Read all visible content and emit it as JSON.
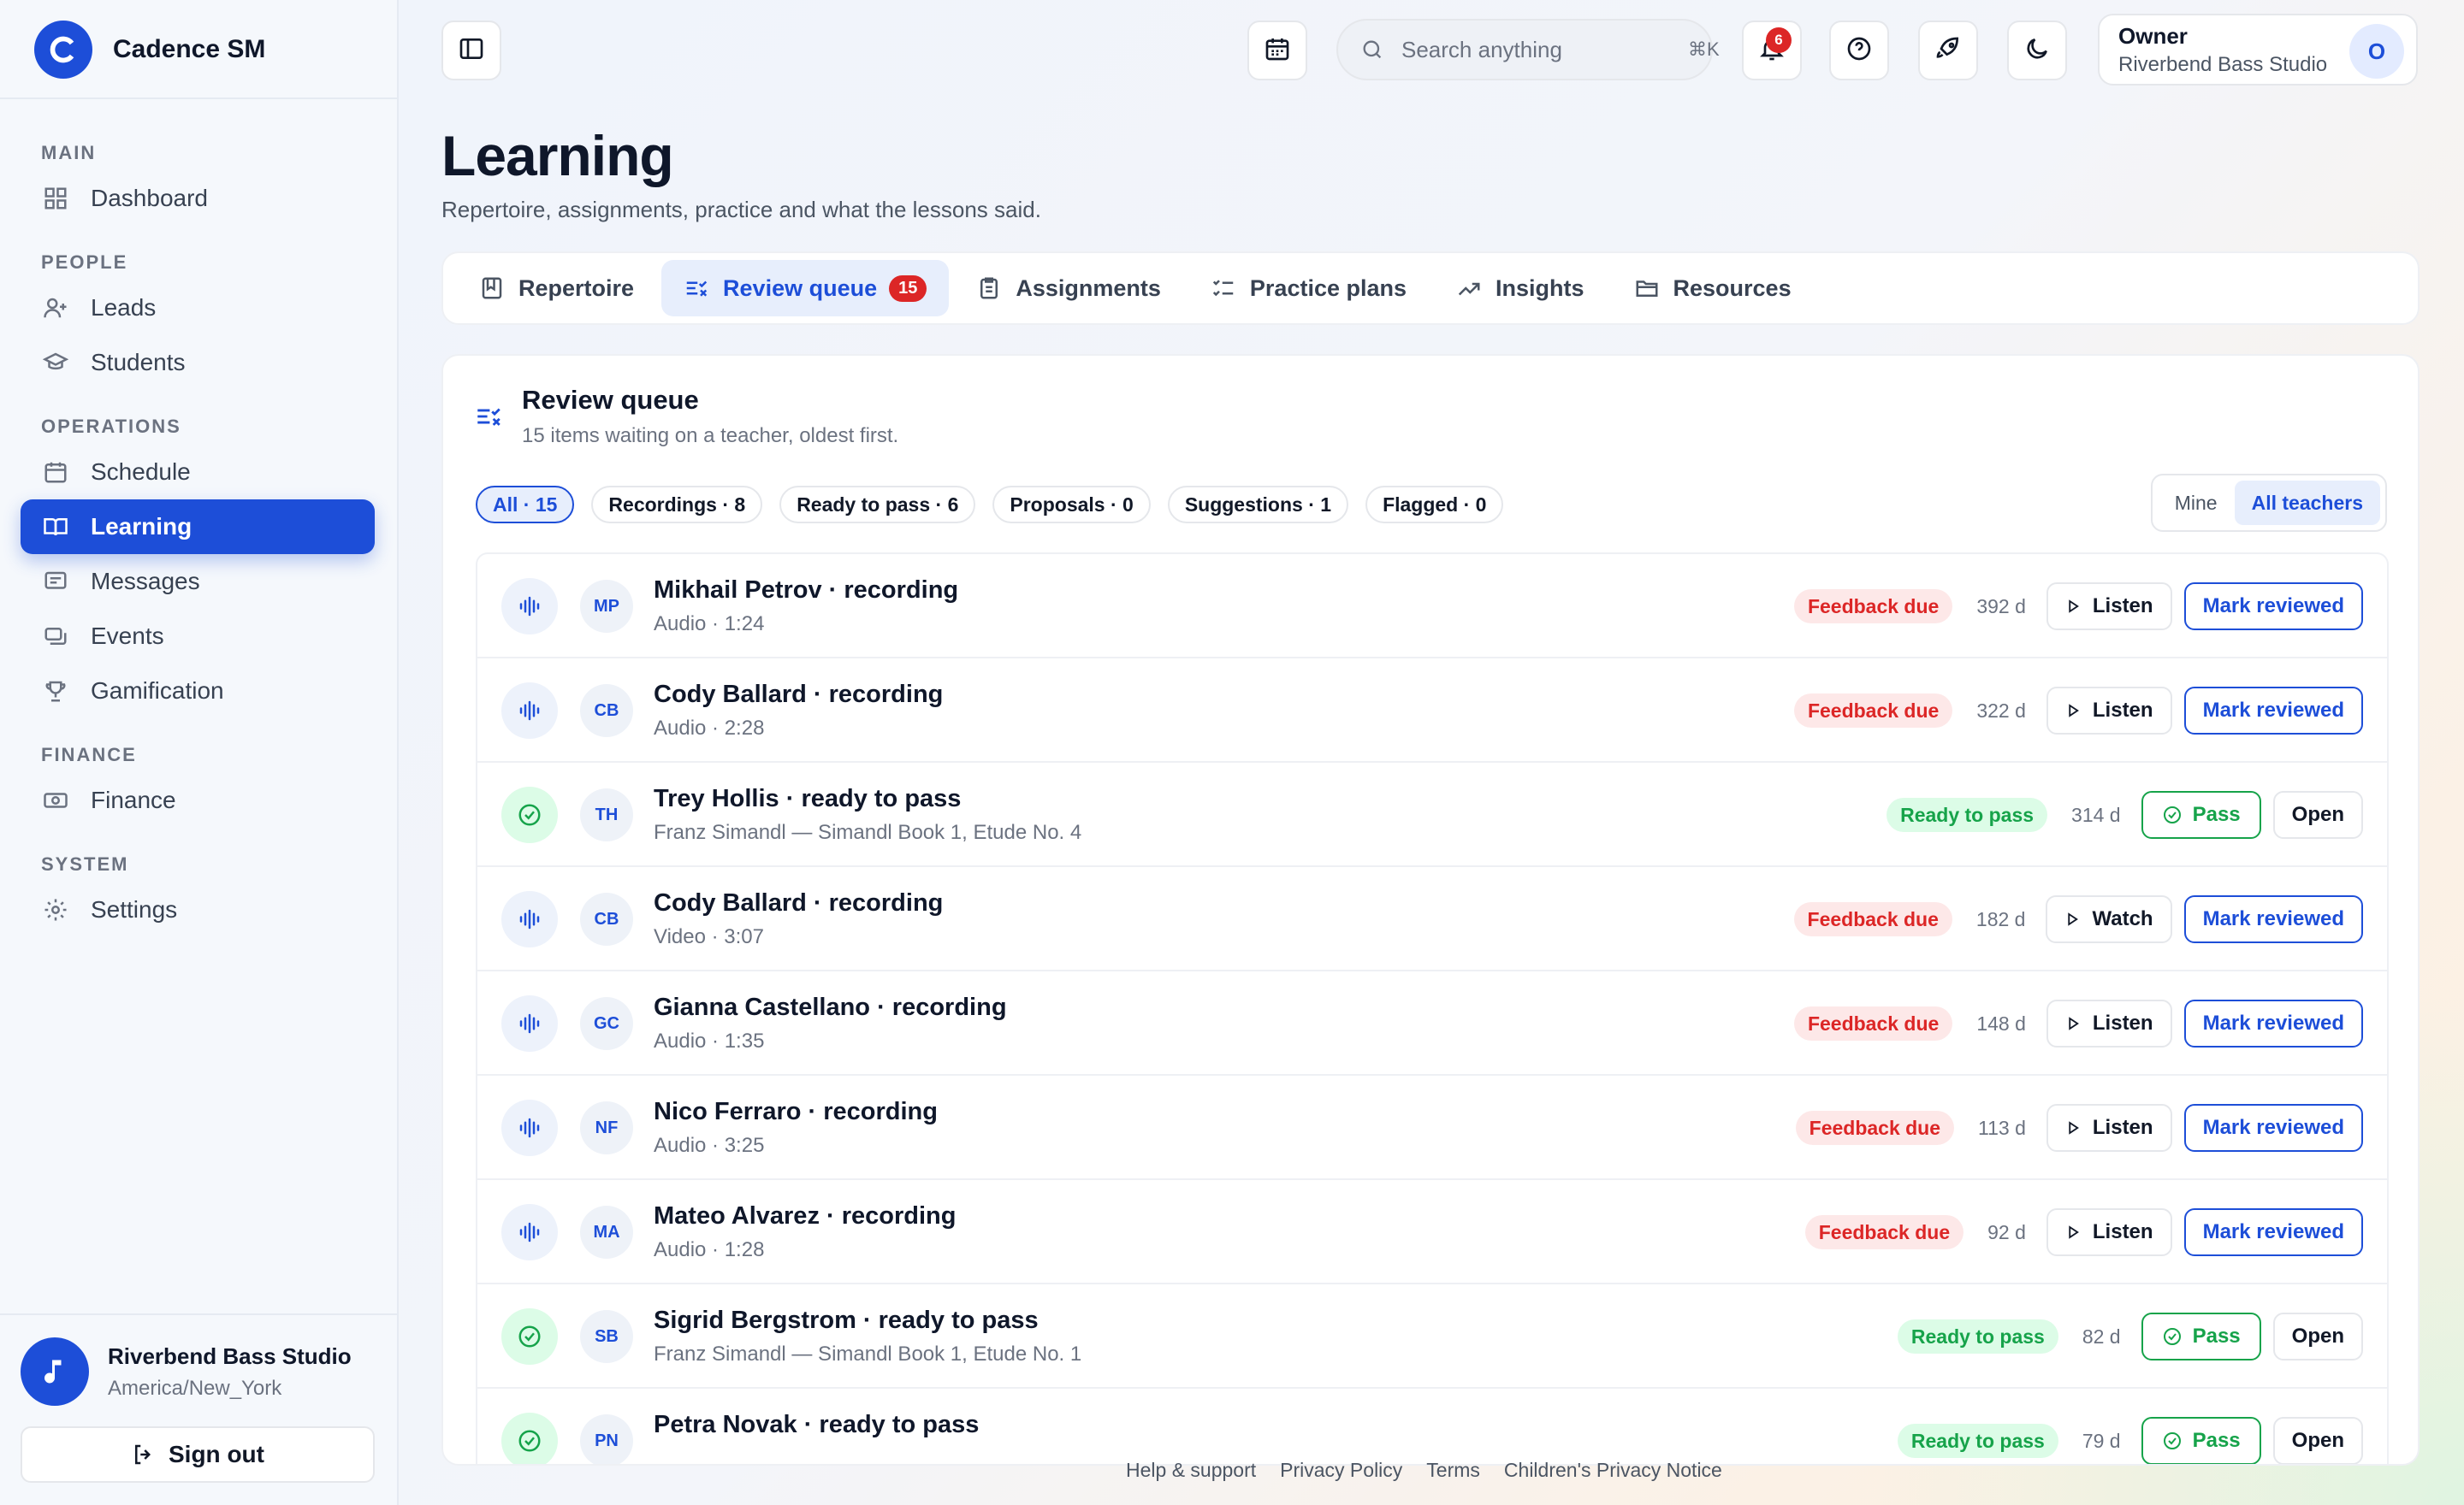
{
  "brand": {
    "logo_letter": "C",
    "name": "Cadence SM"
  },
  "sidebar": {
    "sections": [
      {
        "label": "MAIN"
      },
      {
        "label": "PEOPLE"
      },
      {
        "label": "OPERATIONS"
      },
      {
        "label": "FINANCE"
      },
      {
        "label": "SYSTEM"
      }
    ],
    "items": [
      {
        "label": "Dashboard",
        "icon": "dashboard-icon"
      },
      {
        "label": "Leads",
        "icon": "user-plus-icon"
      },
      {
        "label": "Students",
        "icon": "graduation-cap-icon"
      },
      {
        "label": "Schedule",
        "icon": "calendar-icon"
      },
      {
        "label": "Learning",
        "icon": "book-open-icon",
        "active": true
      },
      {
        "label": "Messages",
        "icon": "message-icon"
      },
      {
        "label": "Events",
        "icon": "ticket-icon"
      },
      {
        "label": "Gamification",
        "icon": "trophy-icon"
      },
      {
        "label": "Finance",
        "icon": "banknote-icon"
      },
      {
        "label": "Settings",
        "icon": "gear-icon"
      }
    ],
    "studio": {
      "name": "Riverbend Bass Studio",
      "timezone": "America/New_York",
      "avatar_icon": "music-note-icon"
    },
    "signout_label": "Sign out"
  },
  "topbar": {
    "search_placeholder": "Search anything",
    "search_shortcut": "⌘K",
    "notifications_count": "6",
    "owner": {
      "role": "Owner",
      "studio": "Riverbend Bass Studio",
      "avatar_letter": "O"
    }
  },
  "page": {
    "title": "Learning",
    "subtitle": "Repertoire, assignments, practice and what the lessons said."
  },
  "tabs": [
    {
      "label": "Repertoire",
      "icon": "repertoire-icon"
    },
    {
      "label": "Review queue",
      "icon": "review-queue-icon",
      "active": true,
      "count": "15"
    },
    {
      "label": "Assignments",
      "icon": "clipboard-icon"
    },
    {
      "label": "Practice plans",
      "icon": "checklist-icon"
    },
    {
      "label": "Insights",
      "icon": "trend-icon"
    },
    {
      "label": "Resources",
      "icon": "folder-icon"
    }
  ],
  "review": {
    "title": "Review queue",
    "subtitle": "15 items waiting on a teacher, oldest first.",
    "filters": [
      {
        "label": "All · 15",
        "active": true
      },
      {
        "label": "Recordings · 8"
      },
      {
        "label": "Ready to pass · 6"
      },
      {
        "label": "Proposals · 0"
      },
      {
        "label": "Suggestions · 1"
      },
      {
        "label": "Flagged · 0"
      }
    ],
    "scope": {
      "mine": "Mine",
      "all": "All teachers",
      "active": "all"
    },
    "rows": [
      {
        "kind": "recording",
        "initials": "MP",
        "title": "Mikhail Petrov · recording",
        "sub": "Audio · 1:24",
        "badge": "Feedback due",
        "age": "392  d",
        "primary": "Listen",
        "secondary": "Mark reviewed"
      },
      {
        "kind": "recording",
        "initials": "CB",
        "title": "Cody Ballard · recording",
        "sub": "Audio · 2:28",
        "badge": "Feedback due",
        "age": "322  d",
        "primary": "Listen",
        "secondary": "Mark reviewed"
      },
      {
        "kind": "pass",
        "initials": "TH",
        "title": "Trey Hollis · ready to pass",
        "sub": "Franz Simandl — Simandl Book 1, Etude No. 4",
        "badge": "Ready to pass",
        "age": "314  d",
        "primary": "Pass",
        "secondary": "Open"
      },
      {
        "kind": "recording",
        "initials": "CB",
        "title": "Cody Ballard · recording",
        "sub": "Video · 3:07",
        "badge": "Feedback due",
        "age": "182  d",
        "primary": "Watch",
        "secondary": "Mark reviewed"
      },
      {
        "kind": "recording",
        "initials": "GC",
        "title": "Gianna Castellano · recording",
        "sub": "Audio · 1:35",
        "badge": "Feedback due",
        "age": "148  d",
        "primary": "Listen",
        "secondary": "Mark reviewed"
      },
      {
        "kind": "recording",
        "initials": "NF",
        "title": "Nico Ferraro · recording",
        "sub": "Audio · 3:25",
        "badge": "Feedback due",
        "age": "113  d",
        "primary": "Listen",
        "secondary": "Mark reviewed"
      },
      {
        "kind": "recording",
        "initials": "MA",
        "title": "Mateo Alvarez · recording",
        "sub": "Audio · 1:28",
        "badge": "Feedback due",
        "age": "92  d",
        "primary": "Listen",
        "secondary": "Mark reviewed"
      },
      {
        "kind": "pass",
        "initials": "SB",
        "title": "Sigrid Bergstrom · ready to pass",
        "sub": "Franz Simandl — Simandl Book 1, Etude No. 1",
        "badge": "Ready to pass",
        "age": "82  d",
        "primary": "Pass",
        "secondary": "Open"
      },
      {
        "kind": "pass",
        "initials": "PN",
        "title": "Petra Novak · ready to pass",
        "sub": "",
        "badge": "Ready to pass",
        "age": "79  d",
        "primary": "Pass",
        "secondary": "Open"
      }
    ]
  },
  "footer": {
    "links": [
      "Help & support",
      "Privacy Policy",
      "Terms",
      "Children's Privacy Notice"
    ]
  },
  "colors": {
    "accent": "#1d4ed8",
    "danger": "#dc2626",
    "success": "#16a34a"
  }
}
